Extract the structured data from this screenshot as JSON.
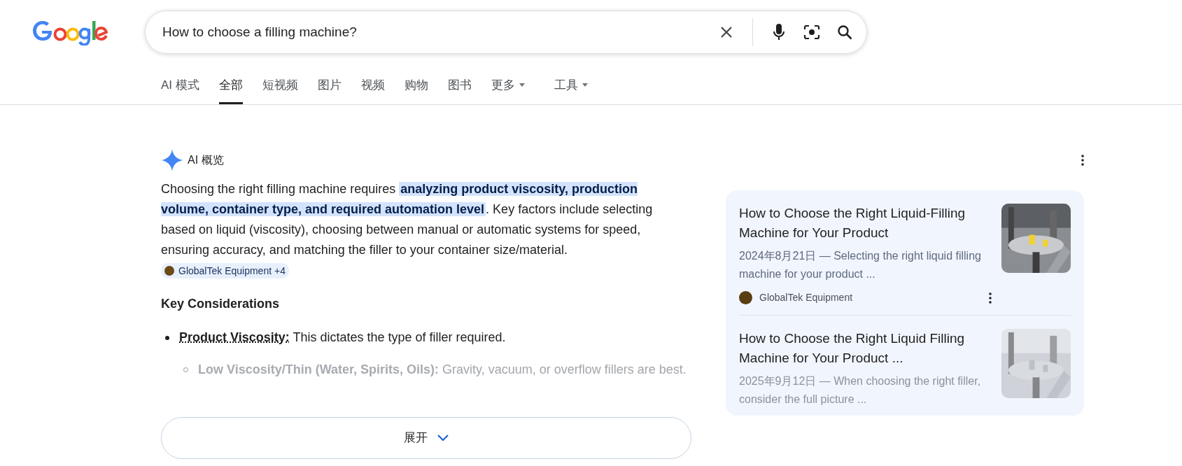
{
  "search": {
    "query": "How to choose a filling machine?"
  },
  "tabs": [
    {
      "label": "AI 模式",
      "selected": false,
      "dropdown": false
    },
    {
      "label": "全部",
      "selected": true,
      "dropdown": false
    },
    {
      "label": "短视频",
      "selected": false,
      "dropdown": false
    },
    {
      "label": "图片",
      "selected": false,
      "dropdown": false
    },
    {
      "label": "视频",
      "selected": false,
      "dropdown": false
    },
    {
      "label": "购物",
      "selected": false,
      "dropdown": false
    },
    {
      "label": "图书",
      "selected": false,
      "dropdown": false
    },
    {
      "label": "更多",
      "selected": false,
      "dropdown": true
    },
    {
      "label": "工具",
      "selected": false,
      "dropdown": true
    }
  ],
  "ai_overview": {
    "title": "AI 概览",
    "summary": "Choosing the right filling machine requires **analyzing product viscosity, production volume, container type, and required automation level**. Key factors include selecting based on liquid (viscosity), choosing between manual or automatic systems for speed, ensuring accuracy, and matching the filler to your container size/material.",
    "citation": "GlobalTek Equipment +4",
    "heading": "Key Considerations",
    "bullets": [
      {
        "text": "**Product Viscosity:** This dictates the type of filler required.",
        "faded": false,
        "children": [
          {
            "text": "**Low Viscosity/Thin (Water, Spirits, Oils):** Gravity, vacuum, or overflow fillers are best.",
            "faded": true
          }
        ]
      }
    ],
    "expand_label": "展开"
  },
  "sources": [
    {
      "title": "How to Choose the Right Liquid-Filling Machine for Your Product",
      "snippet": "2024年8月21日 — Selecting the right liquid filling machine for your product ...",
      "site": "GlobalTek Equipment",
      "faded": false
    },
    {
      "title": "How to Choose the Right Liquid Filling Machine for Your Product ...",
      "snippet": "2025年9月12日 — When choosing the right filler, consider the full picture ...",
      "faded": true
    }
  ]
}
